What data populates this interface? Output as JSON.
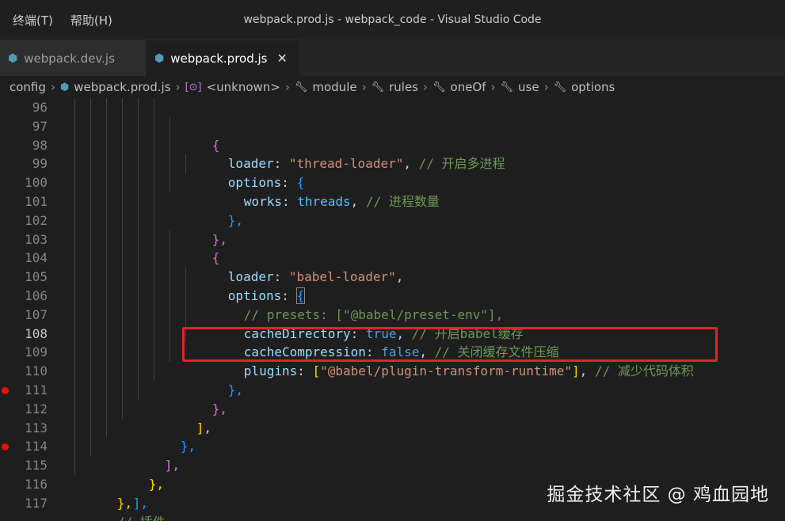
{
  "menu": {
    "terminal": "终端(T)",
    "help": "帮助(H)"
  },
  "window_title": "webpack.prod.js - webpack_code - Visual Studio Code",
  "tabs": [
    {
      "label": "webpack.dev.js",
      "active": false
    },
    {
      "label": "webpack.prod.js",
      "active": true
    }
  ],
  "breadcrumb": [
    "config",
    "webpack.prod.js",
    "<unknown>",
    "module",
    "rules",
    "oneOf",
    "use",
    "options"
  ],
  "editor": {
    "line_numbers": [
      "96",
      "97",
      "98",
      "99",
      "100",
      "101",
      "102",
      "103",
      "104",
      "105",
      "106",
      "107",
      "108",
      "109",
      "110",
      "111",
      "112",
      "113",
      "114",
      "115",
      "116",
      "117"
    ],
    "breakpoint_lines": [
      "111",
      "114"
    ],
    "current_line": "108",
    "code": {
      "l96": "{",
      "l97_key": "loader",
      "l97_val": "\"thread-loader\"",
      "l97_cmt": "// 开启多进程",
      "l98_key": "options",
      "l99_key": "works",
      "l99_val": "threads",
      "l99_cmt": "// 进程数量",
      "l100": "},",
      "l101": "},",
      "l102": "{",
      "l103_key": "loader",
      "l103_val": "\"babel-loader\"",
      "l104_key": "options",
      "l105_cmt": "// presets: [\"@babel/preset-env\"],",
      "l106_key": "cacheDirectory",
      "l106_val": "true",
      "l106_cmt": "// 开启babel缓存",
      "l107_key": "cacheCompression",
      "l107_val": "false",
      "l107_cmt": "// 关闭缓存文件压缩",
      "l108_key": "plugins",
      "l108_val": "\"@babel/plugin-transform-runtime\"",
      "l108_cmt": "// 减少代码体积",
      "l109": "},",
      "l110": "},",
      "l111": "],",
      "l112": "},",
      "l113": "],",
      "l114": "},",
      "l115": "],",
      "l116": "},",
      "l117_cmt": "// 插件"
    }
  },
  "watermark": "掘金技术社区 @ 鸡血园地",
  "colors": {
    "annotation_box": "#e8202a",
    "breakpoint": "#e51400"
  }
}
